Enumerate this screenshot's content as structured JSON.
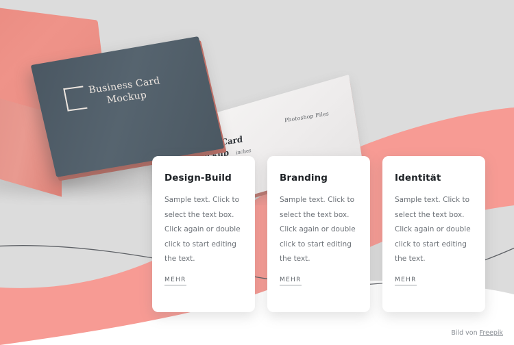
{
  "page": {
    "background_color": "#dcdcdc",
    "accent_color": "#f79b94",
    "dark_card_color": "#4d5a66"
  },
  "hero": {
    "dark_card": {
      "logo_icon": "square-outline-logo-icon",
      "line1": "Business Card",
      "line2": "Mockup"
    },
    "white_card": {
      "line1": "Business Card",
      "line2": "Mockup",
      "size_note": "inches",
      "files_note": "Photoshop Files"
    }
  },
  "cards": [
    {
      "title": "Design-Build",
      "body": "Sample text. Click to select the text box. Click again or double click to start editing the text.",
      "link": "MEHR"
    },
    {
      "title": "Branding",
      "body": "Sample text. Click to select the text box. Click again or double click to start editing the text.",
      "link": "MEHR"
    },
    {
      "title": "Identität",
      "body": "Sample text. Click to select the text box. Click again or double click to start editing the text.",
      "link": "MEHR"
    }
  ],
  "footer": {
    "prefix": "Bild von ",
    "link": "Freepik"
  }
}
